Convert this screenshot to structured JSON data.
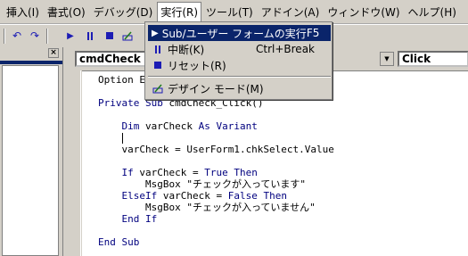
{
  "menubar": {
    "items": [
      "挿入(I)",
      "書式(O)",
      "デバッグ(D)",
      "実行(R)",
      "ツール(T)",
      "アドイン(A)",
      "ウィンドウ(W)",
      "ヘルプ(H)"
    ]
  },
  "run_menu": {
    "items": [
      {
        "label": "Sub/ユーザー フォームの実行",
        "shortcut": "F5",
        "icon": "play-icon"
      },
      {
        "label": "中断(K)",
        "shortcut": "Ctrl+Break",
        "icon": "pause-icon"
      },
      {
        "label": "リセット(R)",
        "shortcut": "",
        "icon": "stop-icon"
      },
      {
        "label": "デザイン モード(M)",
        "shortcut": "",
        "icon": "design-mode-icon"
      }
    ]
  },
  "code_window": {
    "object_combo": "cmdCheck",
    "procedure_combo": "Click",
    "lines": [
      "Option E",
      "",
      "Private Sub cmdCheck_Click()",
      "",
      "    Dim varCheck As Variant",
      "",
      "    varCheck = UserForm1.chkSelect.Value",
      "",
      "    If varCheck = True Then",
      "        MsgBox \"チェックが入っています\"",
      "    ElseIf varCheck = False Then",
      "        MsgBox \"チェックが入っていません\"",
      "    End If",
      "",
      "End Sub"
    ]
  },
  "colors": {
    "highlight": "#0a246a",
    "keyword": "#00007f",
    "toolbar_icon": "#1c1cb4"
  }
}
